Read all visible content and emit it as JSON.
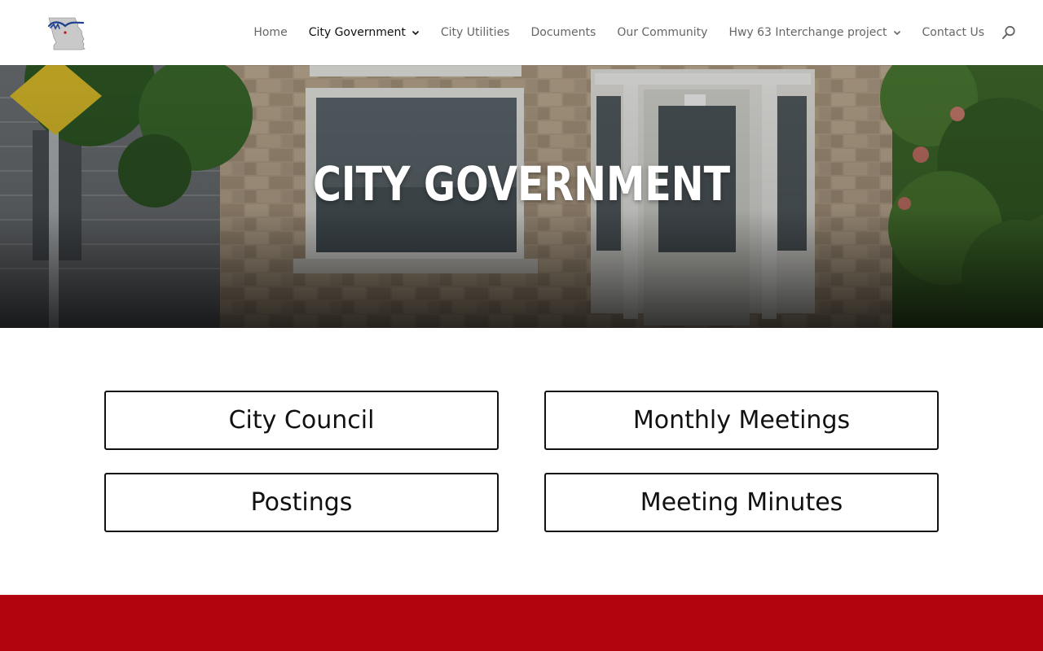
{
  "site": {
    "logo_icon": "westphalia-missouri-logo"
  },
  "nav": {
    "items": [
      {
        "label": "Home",
        "has_dropdown": false,
        "active": false
      },
      {
        "label": "City Government",
        "has_dropdown": true,
        "active": true
      },
      {
        "label": "City Utilities",
        "has_dropdown": false,
        "active": false
      },
      {
        "label": "Documents",
        "has_dropdown": false,
        "active": false
      },
      {
        "label": "Our Community",
        "has_dropdown": false,
        "active": false
      },
      {
        "label": "Hwy 63 Interchange project",
        "has_dropdown": true,
        "active": false
      },
      {
        "label": "Contact Us",
        "has_dropdown": false,
        "active": false
      }
    ],
    "search_icon": "search-icon"
  },
  "hero": {
    "title": "CITY GOVERNMENT"
  },
  "buttons": {
    "city_council": "City Council",
    "monthly_meetings": "Monthly Meetings",
    "postings": "Postings",
    "meeting_minutes": "Meeting Minutes"
  },
  "colors": {
    "footer_band": "#b1040e",
    "nav_active": "#111111",
    "nav_default": "#666666"
  }
}
